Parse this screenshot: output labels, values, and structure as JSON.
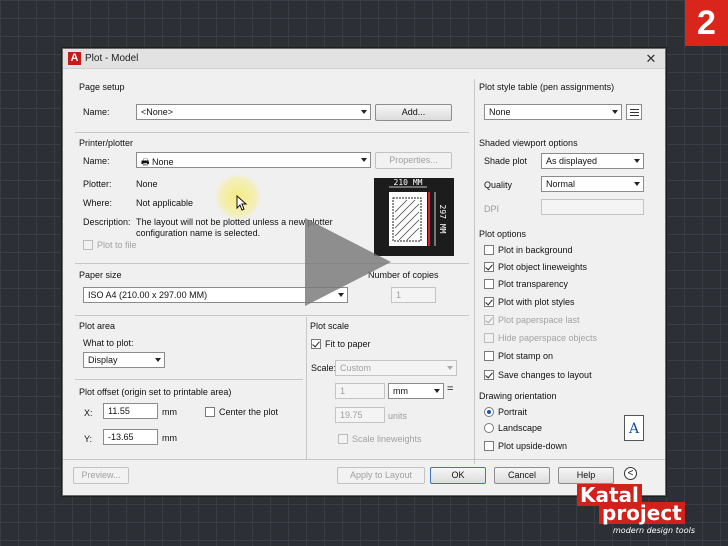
{
  "badge": "2",
  "dialog": {
    "title": "Plot - Model",
    "close_glyph": "✕",
    "page_setup": {
      "heading": "Page setup",
      "name_label": "Name:",
      "name_value": "<None>",
      "add_button": "Add..."
    },
    "printer": {
      "heading": "Printer/plotter",
      "name_label": "Name:",
      "name_value": "None",
      "properties_button": "Properties...",
      "plotter_label": "Plotter:",
      "plotter_value": "None",
      "where_label": "Where:",
      "where_value": "Not applicable",
      "description_label": "Description:",
      "description_line1": "The layout will not be plotted unless a new plotter",
      "description_line2": "configuration name is selected.",
      "plot_to_file": "Plot to file"
    },
    "preview": {
      "width_label": "210 MM",
      "height_label": "297 MM"
    },
    "paper_size": {
      "heading": "Paper size",
      "value": "ISO A4 (210.00 x 297.00 MM)"
    },
    "copies": {
      "heading": "Number of copies",
      "value": "1"
    },
    "plot_area": {
      "heading": "Plot area",
      "what_label": "What to plot:",
      "value": "Display"
    },
    "plot_offset": {
      "heading": "Plot offset (origin set to printable area)",
      "x_label": "X:",
      "x_value": "11.55",
      "x_unit": "mm",
      "y_label": "Y:",
      "y_value": "-13.65",
      "y_unit": "mm",
      "center": "Center the plot"
    },
    "plot_scale": {
      "heading": "Plot scale",
      "fit": "Fit to paper",
      "scale_label": "Scale:",
      "scale_value": "Custom",
      "num_value": "1",
      "unit_value": "mm",
      "eq": "=",
      "units_value": "19.75",
      "units_label": "units",
      "lineweights": "Scale lineweights"
    },
    "right": {
      "style_table_heading": "Plot style table (pen assignments)",
      "style_table_value": "None",
      "shaded_heading": "Shaded viewport options",
      "shade_label": "Shade plot",
      "shade_value": "As displayed",
      "quality_label": "Quality",
      "quality_value": "Normal",
      "dpi_label": "DPI",
      "plot_options_heading": "Plot options",
      "options": [
        {
          "label": "Plot in background",
          "checked": false,
          "enabled": true
        },
        {
          "label": "Plot object lineweights",
          "checked": true,
          "enabled": true
        },
        {
          "label": "Plot transparency",
          "checked": false,
          "enabled": true
        },
        {
          "label": "Plot with plot styles",
          "checked": true,
          "enabled": true
        },
        {
          "label": "Plot paperspace last",
          "checked": true,
          "enabled": false
        },
        {
          "label": "Hide paperspace objects",
          "checked": false,
          "enabled": false
        },
        {
          "label": "Plot stamp on",
          "checked": false,
          "enabled": true
        },
        {
          "label": "Save changes to layout",
          "checked": true,
          "enabled": true
        }
      ],
      "orientation_heading": "Drawing orientation",
      "portrait": "Portrait",
      "landscape": "Landscape",
      "upside_down": "Plot upside-down",
      "orientation_glyph": "A"
    },
    "buttons": {
      "preview": "Preview...",
      "apply": "Apply to Layout",
      "ok": "OK",
      "cancel": "Cancel",
      "help": "Help",
      "more": "<"
    }
  },
  "watermark": {
    "line1": "Katal",
    "line2": "project",
    "tagline": "modern design tools"
  }
}
